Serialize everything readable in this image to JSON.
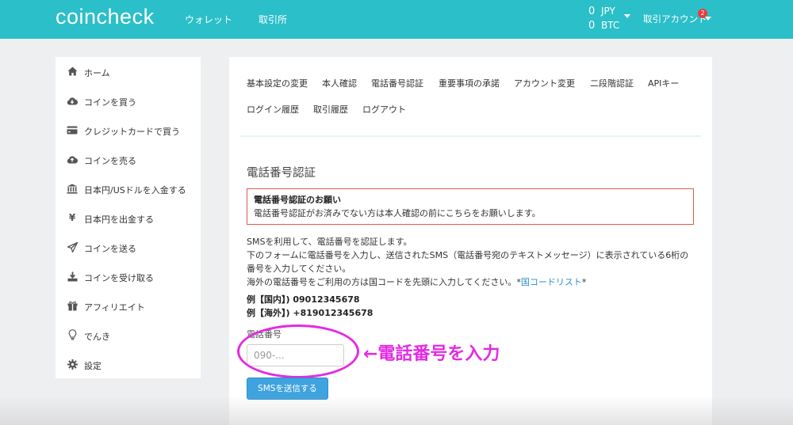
{
  "header": {
    "logo": "coincheck",
    "nav": [
      "ウォレット",
      "取引所"
    ],
    "balances": [
      {
        "amount": "0",
        "currency": "JPY"
      },
      {
        "amount": "0",
        "currency": "BTC"
      }
    ],
    "account_label": "取引アカウント",
    "notification_count": "2"
  },
  "sidebar": {
    "items": [
      {
        "label": "ホーム",
        "icon": "home-icon"
      },
      {
        "label": "コインを買う",
        "icon": "cloud-download-icon"
      },
      {
        "label": "クレジットカードで買う",
        "icon": "credit-card-icon"
      },
      {
        "label": "コインを売る",
        "icon": "cloud-upload-icon"
      },
      {
        "label": "日本円/USドルを入金する",
        "icon": "bank-icon"
      },
      {
        "label": "日本円を出金する",
        "icon": "yen-icon"
      },
      {
        "label": "コインを送る",
        "icon": "send-icon"
      },
      {
        "label": "コインを受け取る",
        "icon": "download-icon"
      },
      {
        "label": "アフィリエイト",
        "icon": "gift-icon"
      },
      {
        "label": "でんき",
        "icon": "lightbulb-icon"
      },
      {
        "label": "設定",
        "icon": "gear-icon"
      }
    ]
  },
  "tabs": [
    "基本設定の変更",
    "本人確認",
    "電話番号認証",
    "重要事項の承諾",
    "アカウント変更",
    "二段階認証",
    "APIキー",
    "ログイン履歴",
    "取引履歴",
    "ログアウト"
  ],
  "main": {
    "title": "電話番号認証",
    "alert_title": "電話番号認証のお願い",
    "alert_body": "電話番号認証がお済みでない方は本人確認の前にこちらをお願いします。",
    "desc1": "SMSを利用して、電話番号を認証します。",
    "desc2": "下のフォームに電話番号を入力し、送信されたSMS（電話番号宛のテキストメッセージ）に表示されている6桁の",
    "desc3": "番号を入力してください。",
    "desc4_pre": "海外の電話番号をご利用の方は国コードを先頭に入力してください。*",
    "desc4_link": "国コードリスト",
    "desc4_post": "*",
    "example_domestic": "例【国内】) 09012345678",
    "example_overseas": "例【海外】) +819012345678",
    "field_label": "電話番号",
    "field_placeholder": "090-...",
    "submit_label": "SMSを送信する"
  },
  "annotation": "←電話番号を入力",
  "colors": {
    "header": "#2bbfc9",
    "button": "#3ea3de",
    "alert_border": "#e3584f",
    "annotation": "#e42ae4",
    "link": "#2a8ec9"
  }
}
